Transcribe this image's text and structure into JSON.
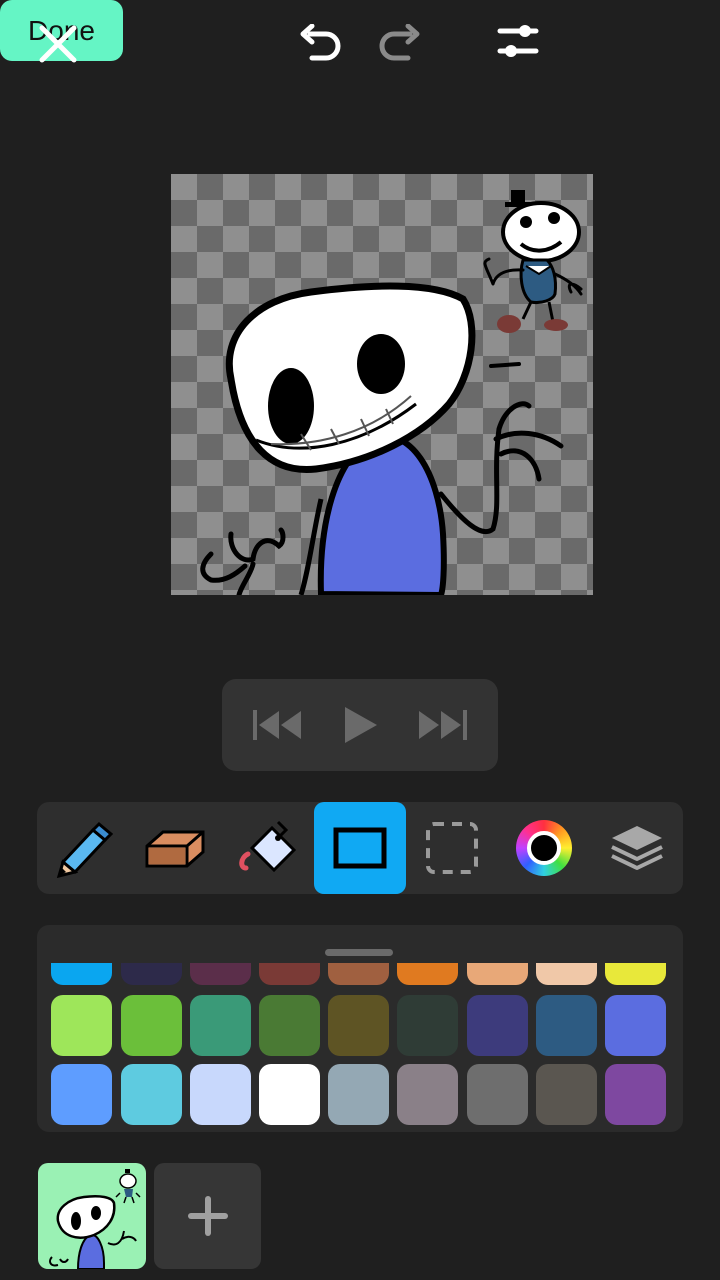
{
  "toolbar": {
    "done_label": "Done",
    "icons": [
      "close-icon",
      "undo-icon",
      "redo-icon",
      "sliders-icon"
    ]
  },
  "playback": {
    "icons": [
      "skip-back-icon",
      "play-icon",
      "skip-forward-icon"
    ]
  },
  "tools": [
    {
      "name": "pencil",
      "icon": "pencil-icon",
      "active": false
    },
    {
      "name": "eraser",
      "icon": "eraser-icon",
      "active": false
    },
    {
      "name": "fill",
      "icon": "paint-bucket-icon",
      "active": false
    },
    {
      "name": "rectangle",
      "icon": "rectangle-icon",
      "active": true
    },
    {
      "name": "select",
      "icon": "dashed-select-icon",
      "active": false
    },
    {
      "name": "color",
      "icon": "color-wheel-icon",
      "active": false
    },
    {
      "name": "layers",
      "icon": "layers-icon",
      "active": false
    }
  ],
  "palette": {
    "partial_row": [
      "#0aa6f0",
      "#2d2a4a",
      "#5b2e4a",
      "#7a3a36",
      "#a06040",
      "#e07a20",
      "#e8a878",
      "#f0c8a8",
      "#e8e83a"
    ],
    "row_1": [
      "#9ee65a",
      "#6bbf3a",
      "#3a9a78",
      "#4a7a34",
      "#5e5424",
      "#2f3c36",
      "#3d3b7c",
      "#2d5b82",
      "#5b6de0"
    ],
    "row_2": [
      "#5e9dff",
      "#5ecbe0",
      "#c8d8fc",
      "#ffffff",
      "#94a8b4",
      "#8a8088",
      "#6e6e6e",
      "#5a5650",
      "#7e48a0"
    ]
  },
  "colors": {
    "accent": "#65f5c5",
    "active_tool": "#10a9f3",
    "background": "#1f1f1f"
  }
}
